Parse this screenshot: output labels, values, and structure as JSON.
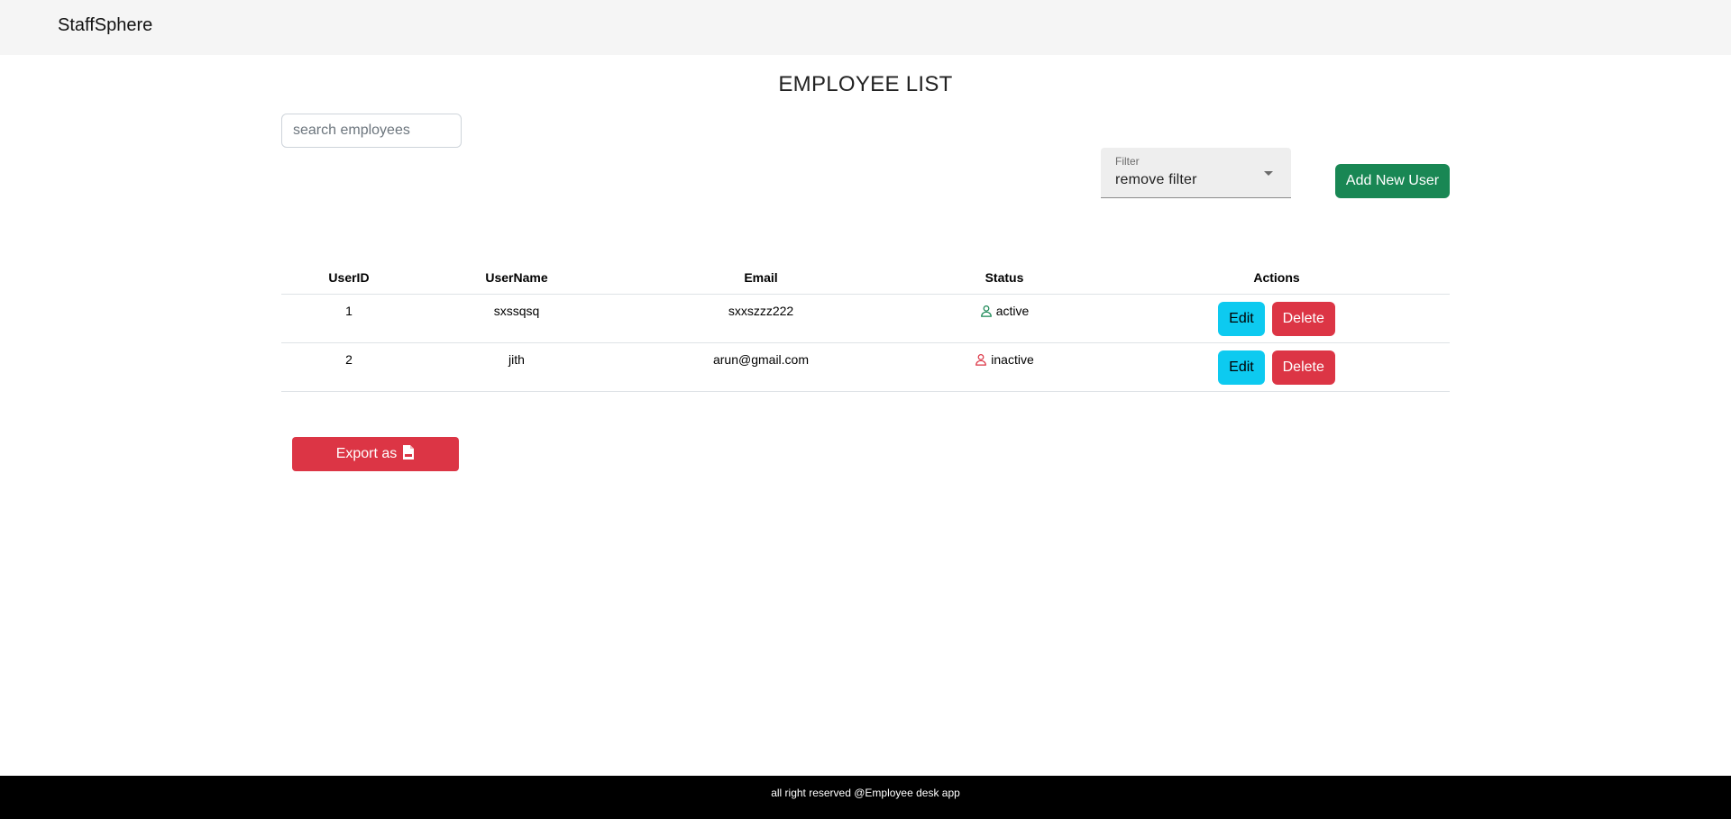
{
  "navbar": {
    "brand": "StaffSphere"
  },
  "page": {
    "title": "EMPLOYEE LIST"
  },
  "search": {
    "placeholder": "search employees",
    "value": ""
  },
  "filter": {
    "label": "Filter",
    "value": "remove filter",
    "icon": "chevron-down-icon"
  },
  "add_button": {
    "label": "Add New User"
  },
  "table": {
    "headers": [
      "UserID",
      "UserName",
      "Email",
      "Status",
      "Actions"
    ],
    "rows": [
      {
        "id": "1",
        "username": "sxssqsq",
        "email": "sxxszzz222",
        "status": "active",
        "status_icon": "user-icon",
        "status_color": "#198754",
        "edit_label": "Edit",
        "delete_label": "Delete"
      },
      {
        "id": "2",
        "username": "jith",
        "email": "arun@gmail.com",
        "status": "inactive",
        "status_icon": "user-icon",
        "status_color": "#dc3545",
        "edit_label": "Edit",
        "delete_label": "Delete"
      }
    ]
  },
  "export_button": {
    "label": "Export as",
    "icon": "pdf-file-icon"
  },
  "footer": {
    "text": "all right reserved @Employee desk app"
  },
  "colors": {
    "primary_success": "#198754",
    "danger": "#dc3545",
    "info": "#0dcaf0",
    "navbar_bg": "#f5f5f5",
    "footer_bg": "#000000"
  }
}
